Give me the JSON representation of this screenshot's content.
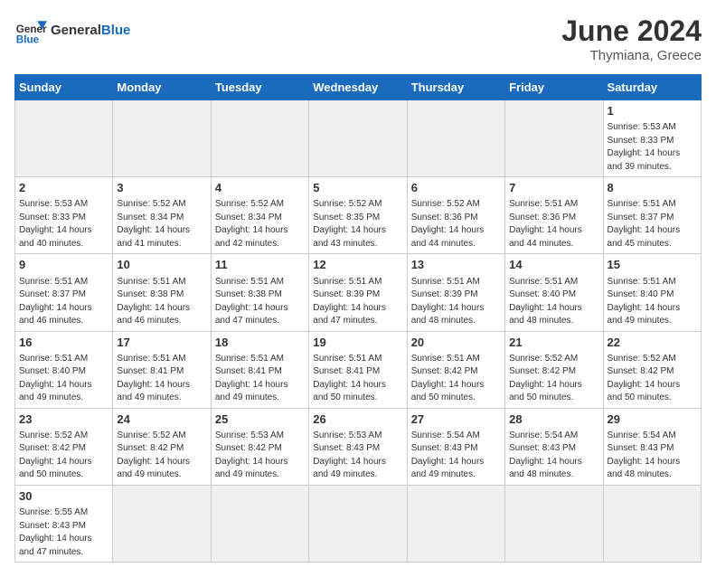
{
  "header": {
    "logo_general": "General",
    "logo_blue": "Blue",
    "month_year": "June 2024",
    "location": "Thymiana, Greece"
  },
  "days_of_week": [
    "Sunday",
    "Monday",
    "Tuesday",
    "Wednesday",
    "Thursday",
    "Friday",
    "Saturday"
  ],
  "weeks": [
    [
      {
        "day": "",
        "info": "",
        "empty": true
      },
      {
        "day": "",
        "info": "",
        "empty": true
      },
      {
        "day": "",
        "info": "",
        "empty": true
      },
      {
        "day": "",
        "info": "",
        "empty": true
      },
      {
        "day": "",
        "info": "",
        "empty": true
      },
      {
        "day": "",
        "info": "",
        "empty": true
      },
      {
        "day": "1",
        "info": "Sunrise: 5:53 AM\nSunset: 8:33 PM\nDaylight: 14 hours\nand 39 minutes.",
        "empty": false
      }
    ],
    [
      {
        "day": "2",
        "info": "Sunrise: 5:53 AM\nSunset: 8:33 PM\nDaylight: 14 hours\nand 40 minutes.",
        "empty": false
      },
      {
        "day": "3",
        "info": "Sunrise: 5:52 AM\nSunset: 8:34 PM\nDaylight: 14 hours\nand 41 minutes.",
        "empty": false
      },
      {
        "day": "4",
        "info": "Sunrise: 5:52 AM\nSunset: 8:34 PM\nDaylight: 14 hours\nand 42 minutes.",
        "empty": false
      },
      {
        "day": "5",
        "info": "Sunrise: 5:52 AM\nSunset: 8:35 PM\nDaylight: 14 hours\nand 43 minutes.",
        "empty": false
      },
      {
        "day": "6",
        "info": "Sunrise: 5:52 AM\nSunset: 8:36 PM\nDaylight: 14 hours\nand 44 minutes.",
        "empty": false
      },
      {
        "day": "7",
        "info": "Sunrise: 5:51 AM\nSunset: 8:36 PM\nDaylight: 14 hours\nand 44 minutes.",
        "empty": false
      },
      {
        "day": "8",
        "info": "Sunrise: 5:51 AM\nSunset: 8:37 PM\nDaylight: 14 hours\nand 45 minutes.",
        "empty": false
      }
    ],
    [
      {
        "day": "9",
        "info": "Sunrise: 5:51 AM\nSunset: 8:37 PM\nDaylight: 14 hours\nand 46 minutes.",
        "empty": false
      },
      {
        "day": "10",
        "info": "Sunrise: 5:51 AM\nSunset: 8:38 PM\nDaylight: 14 hours\nand 46 minutes.",
        "empty": false
      },
      {
        "day": "11",
        "info": "Sunrise: 5:51 AM\nSunset: 8:38 PM\nDaylight: 14 hours\nand 47 minutes.",
        "empty": false
      },
      {
        "day": "12",
        "info": "Sunrise: 5:51 AM\nSunset: 8:39 PM\nDaylight: 14 hours\nand 47 minutes.",
        "empty": false
      },
      {
        "day": "13",
        "info": "Sunrise: 5:51 AM\nSunset: 8:39 PM\nDaylight: 14 hours\nand 48 minutes.",
        "empty": false
      },
      {
        "day": "14",
        "info": "Sunrise: 5:51 AM\nSunset: 8:40 PM\nDaylight: 14 hours\nand 48 minutes.",
        "empty": false
      },
      {
        "day": "15",
        "info": "Sunrise: 5:51 AM\nSunset: 8:40 PM\nDaylight: 14 hours\nand 49 minutes.",
        "empty": false
      }
    ],
    [
      {
        "day": "16",
        "info": "Sunrise: 5:51 AM\nSunset: 8:40 PM\nDaylight: 14 hours\nand 49 minutes.",
        "empty": false
      },
      {
        "day": "17",
        "info": "Sunrise: 5:51 AM\nSunset: 8:41 PM\nDaylight: 14 hours\nand 49 minutes.",
        "empty": false
      },
      {
        "day": "18",
        "info": "Sunrise: 5:51 AM\nSunset: 8:41 PM\nDaylight: 14 hours\nand 49 minutes.",
        "empty": false
      },
      {
        "day": "19",
        "info": "Sunrise: 5:51 AM\nSunset: 8:41 PM\nDaylight: 14 hours\nand 50 minutes.",
        "empty": false
      },
      {
        "day": "20",
        "info": "Sunrise: 5:51 AM\nSunset: 8:42 PM\nDaylight: 14 hours\nand 50 minutes.",
        "empty": false
      },
      {
        "day": "21",
        "info": "Sunrise: 5:52 AM\nSunset: 8:42 PM\nDaylight: 14 hours\nand 50 minutes.",
        "empty": false
      },
      {
        "day": "22",
        "info": "Sunrise: 5:52 AM\nSunset: 8:42 PM\nDaylight: 14 hours\nand 50 minutes.",
        "empty": false
      }
    ],
    [
      {
        "day": "23",
        "info": "Sunrise: 5:52 AM\nSunset: 8:42 PM\nDaylight: 14 hours\nand 50 minutes.",
        "empty": false
      },
      {
        "day": "24",
        "info": "Sunrise: 5:52 AM\nSunset: 8:42 PM\nDaylight: 14 hours\nand 49 minutes.",
        "empty": false
      },
      {
        "day": "25",
        "info": "Sunrise: 5:53 AM\nSunset: 8:42 PM\nDaylight: 14 hours\nand 49 minutes.",
        "empty": false
      },
      {
        "day": "26",
        "info": "Sunrise: 5:53 AM\nSunset: 8:43 PM\nDaylight: 14 hours\nand 49 minutes.",
        "empty": false
      },
      {
        "day": "27",
        "info": "Sunrise: 5:54 AM\nSunset: 8:43 PM\nDaylight: 14 hours\nand 49 minutes.",
        "empty": false
      },
      {
        "day": "28",
        "info": "Sunrise: 5:54 AM\nSunset: 8:43 PM\nDaylight: 14 hours\nand 48 minutes.",
        "empty": false
      },
      {
        "day": "29",
        "info": "Sunrise: 5:54 AM\nSunset: 8:43 PM\nDaylight: 14 hours\nand 48 minutes.",
        "empty": false
      }
    ],
    [
      {
        "day": "30",
        "info": "Sunrise: 5:55 AM\nSunset: 8:43 PM\nDaylight: 14 hours\nand 47 minutes.",
        "empty": false
      },
      {
        "day": "",
        "info": "",
        "empty": true
      },
      {
        "day": "",
        "info": "",
        "empty": true
      },
      {
        "day": "",
        "info": "",
        "empty": true
      },
      {
        "day": "",
        "info": "",
        "empty": true
      },
      {
        "day": "",
        "info": "",
        "empty": true
      },
      {
        "day": "",
        "info": "",
        "empty": true
      }
    ]
  ]
}
